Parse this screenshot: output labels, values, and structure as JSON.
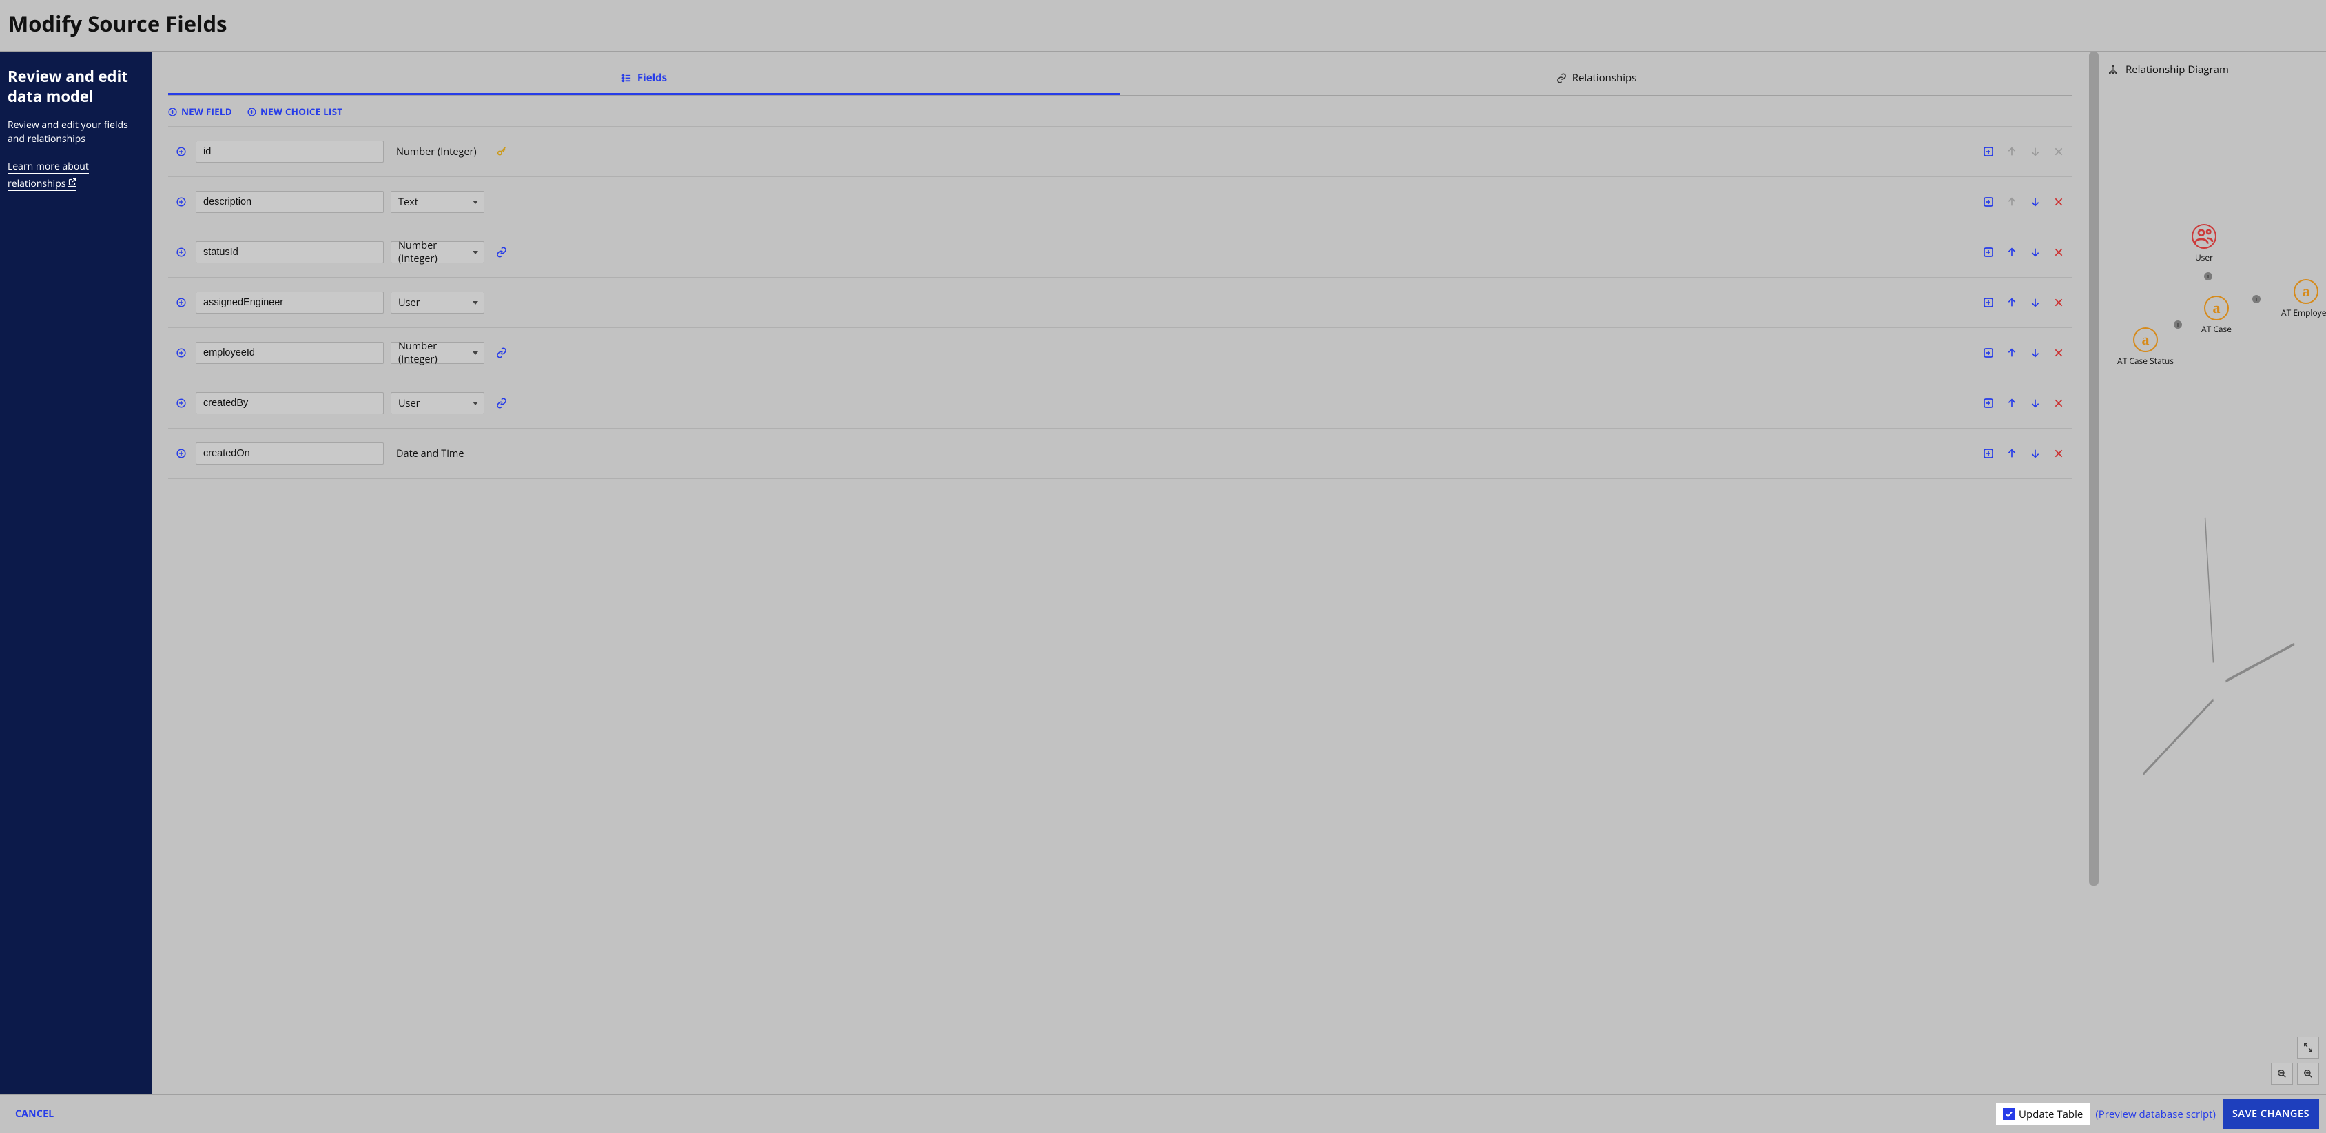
{
  "page_title": "Modify Source Fields",
  "sidebar": {
    "heading": "Review and edit data model",
    "description": "Review and edit your fields and relationships",
    "learn_link": "Learn more about relationships"
  },
  "tabs": {
    "fields": "Fields",
    "relationships": "Relationships"
  },
  "actions": {
    "new_field": "NEW FIELD",
    "new_choice_list": "NEW CHOICE LIST"
  },
  "fields": [
    {
      "name": "id",
      "type": "Number (Integer)",
      "type_editable": false,
      "badge": "key",
      "up": false,
      "down": false,
      "del": false
    },
    {
      "name": "description",
      "type": "Text",
      "type_editable": true,
      "badge": null,
      "up": false,
      "down": true,
      "del": true
    },
    {
      "name": "statusId",
      "type": "Number (Integer)",
      "type_editable": true,
      "badge": "link",
      "up": true,
      "down": true,
      "del": true
    },
    {
      "name": "assignedEngineer",
      "type": "User",
      "type_editable": true,
      "badge": null,
      "up": true,
      "down": true,
      "del": true
    },
    {
      "name": "employeeId",
      "type": "Number (Integer)",
      "type_editable": true,
      "badge": "link",
      "up": true,
      "down": true,
      "del": true
    },
    {
      "name": "createdBy",
      "type": "User",
      "type_editable": true,
      "badge": "link",
      "up": true,
      "down": true,
      "del": true
    },
    {
      "name": "createdOn",
      "type": "Date and Time",
      "type_editable": false,
      "badge": null,
      "up": true,
      "down": true,
      "del": true
    }
  ],
  "diagram": {
    "title": "Relationship Diagram",
    "nodes": {
      "user": "User",
      "at_case": "AT Case",
      "at_case_status": "AT Case Status",
      "at_employee": "AT Employee"
    }
  },
  "footer": {
    "cancel": "CANCEL",
    "update_table": "Update Table",
    "update_checked": true,
    "preview": "(Preview database script)",
    "save": "SAVE CHANGES"
  }
}
